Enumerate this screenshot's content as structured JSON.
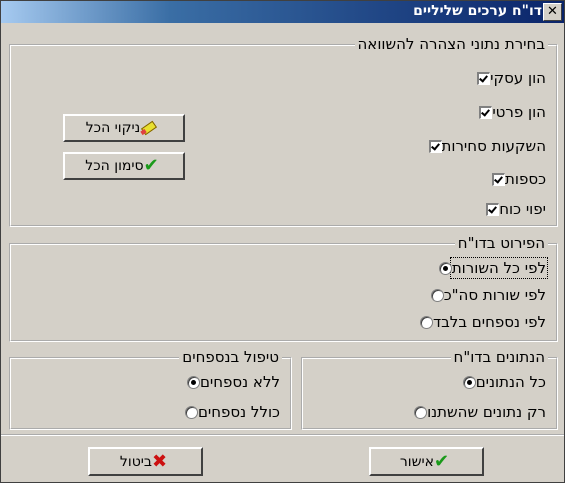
{
  "window": {
    "title": "דו\"ח ערכים שליליים"
  },
  "comparison_group": {
    "legend": "בחירת נתוני הצהרה להשוואה",
    "items": [
      {
        "label": "הון עסקי",
        "checked": true
      },
      {
        "label": "הון פרטי",
        "checked": true
      },
      {
        "label": "השקעות סחירות",
        "checked": true
      },
      {
        "label": "כספות",
        "checked": true
      },
      {
        "label": "יפוי כוח",
        "checked": true
      }
    ],
    "clear_all_label": "ניקוי הכל",
    "select_all_label": "סימון הכל"
  },
  "breakdown_group": {
    "legend": "הפירוט בדו\"ח",
    "options": [
      {
        "label": "לפי כל השורות",
        "selected": true
      },
      {
        "label": "לפי שורות סה\"כ",
        "selected": false
      },
      {
        "label": "לפי נספחים בלבד",
        "selected": false
      }
    ]
  },
  "data_group": {
    "legend": "הנתונים בדו\"ח",
    "options": [
      {
        "label": "כל הנתונים",
        "selected": true
      },
      {
        "label": "רק נתונים שהשתנו",
        "selected": false
      }
    ]
  },
  "appendix_group": {
    "legend": "טיפול בנספחים",
    "options": [
      {
        "label": "ללא נספחים",
        "selected": true
      },
      {
        "label": "כולל נספחים",
        "selected": false
      }
    ]
  },
  "footer": {
    "ok_label": "אישור",
    "cancel_label": "ביטול"
  }
}
